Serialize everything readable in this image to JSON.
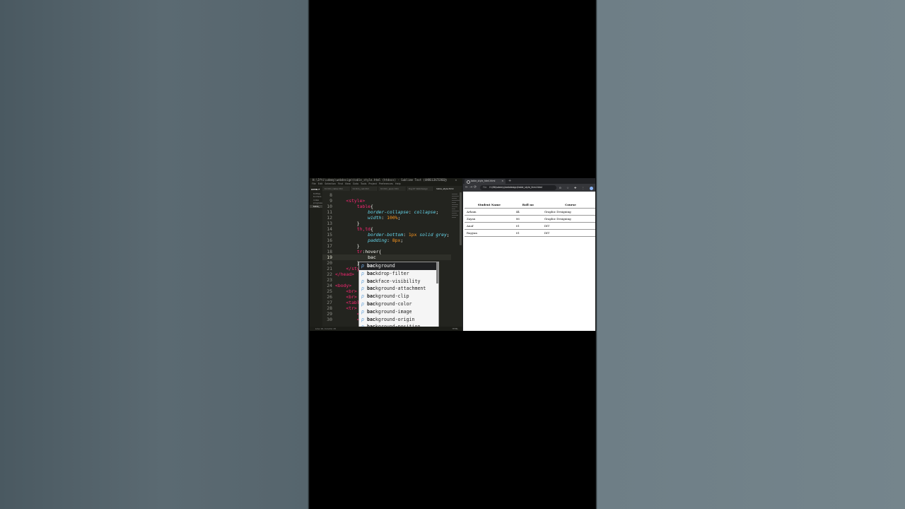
{
  "editor": {
    "title": "H:\\Ifti\\udemy\\webdesign\\table_style.html (htdocs) - Sublime Text (UNREGISTERED)",
    "window_buttons": "–  □  ✕",
    "menu": [
      "File",
      "Edit",
      "Selection",
      "Find",
      "View",
      "Goto",
      "Tools",
      "Project",
      "Preferences",
      "Help"
    ],
    "sidebar_header": "OPEN F",
    "sidebar_files": [
      "tmfiles",
      "borders",
      "index",
      "progress",
      "table_"
    ],
    "tabs": [
      "td.htm_table.htm",
      "td.htm_cell.htm",
      "td.htm_span.htm",
      "Day07 Webdesign",
      "table_style.html"
    ],
    "lines": [
      {
        "n": "8",
        "code": []
      },
      {
        "n": "9",
        "code": [
          {
            "c": "w",
            "t": "    "
          },
          {
            "c": "t",
            "t": "<style>"
          }
        ]
      },
      {
        "n": "10",
        "code": [
          {
            "c": "w",
            "t": "        "
          },
          {
            "c": "t",
            "t": "table"
          },
          {
            "c": "w",
            "t": "{"
          }
        ]
      },
      {
        "n": "11",
        "code": [
          {
            "c": "w",
            "t": "            "
          },
          {
            "c": "pr",
            "t": "border-collapse"
          },
          {
            "c": "w",
            "t": ": "
          },
          {
            "c": "k",
            "t": "collapse"
          },
          {
            "c": "w",
            "t": ";"
          }
        ]
      },
      {
        "n": "12",
        "code": [
          {
            "c": "w",
            "t": "            "
          },
          {
            "c": "pr",
            "t": "width"
          },
          {
            "c": "w",
            "t": ": "
          },
          {
            "c": "v",
            "t": "100%"
          },
          {
            "c": "w",
            "t": ";"
          }
        ]
      },
      {
        "n": "13",
        "code": [
          {
            "c": "w",
            "t": "        }"
          }
        ]
      },
      {
        "n": "14",
        "code": [
          {
            "c": "w",
            "t": "        "
          },
          {
            "c": "t",
            "t": "th,td"
          },
          {
            "c": "w",
            "t": "{"
          }
        ]
      },
      {
        "n": "15",
        "code": [
          {
            "c": "w",
            "t": "            "
          },
          {
            "c": "pr",
            "t": "border-bottom"
          },
          {
            "c": "w",
            "t": ": "
          },
          {
            "c": "v",
            "t": "1px"
          },
          {
            "c": "w",
            "t": " "
          },
          {
            "c": "k",
            "t": "solid grey"
          },
          {
            "c": "w",
            "t": ";"
          }
        ]
      },
      {
        "n": "16",
        "code": [
          {
            "c": "w",
            "t": "            "
          },
          {
            "c": "pr",
            "t": "padding"
          },
          {
            "c": "w",
            "t": ": "
          },
          {
            "c": "v",
            "t": "8px"
          },
          {
            "c": "w",
            "t": ";"
          }
        ]
      },
      {
        "n": "17",
        "code": [
          {
            "c": "w",
            "t": "        }"
          }
        ]
      },
      {
        "n": "18",
        "code": [
          {
            "c": "w",
            "t": "        "
          },
          {
            "c": "t",
            "t": "tr"
          },
          {
            "c": "w",
            "t": ":hover{"
          }
        ]
      },
      {
        "n": "19",
        "code": [
          {
            "c": "w",
            "t": "            bac"
          }
        ]
      },
      {
        "n": "20",
        "code": [
          {
            "c": "w",
            "t": "        }"
          }
        ]
      },
      {
        "n": "21",
        "code": [
          {
            "c": "w",
            "t": "    "
          },
          {
            "c": "t",
            "t": "</sty"
          }
        ]
      },
      {
        "n": "22",
        "code": [
          {
            "c": "t",
            "t": "</head>"
          }
        ]
      },
      {
        "n": "23",
        "code": []
      },
      {
        "n": "24",
        "code": [
          {
            "c": "t",
            "t": "<body>"
          }
        ]
      },
      {
        "n": "25",
        "code": [
          {
            "c": "w",
            "t": "    "
          },
          {
            "c": "t",
            "t": "<br>"
          }
        ]
      },
      {
        "n": "26",
        "code": [
          {
            "c": "w",
            "t": "    "
          },
          {
            "c": "t",
            "t": "<br>"
          }
        ]
      },
      {
        "n": "27",
        "code": [
          {
            "c": "w",
            "t": "    "
          },
          {
            "c": "t",
            "t": "<tabl"
          }
        ]
      },
      {
        "n": "28",
        "code": [
          {
            "c": "w",
            "t": "    "
          },
          {
            "c": "t",
            "t": "<tr>"
          }
        ]
      },
      {
        "n": "29",
        "code": [
          {
            "c": "w",
            "t": "        "
          },
          {
            "c": "t",
            "t": "<"
          }
        ]
      },
      {
        "n": "30",
        "code": [
          {
            "c": "w",
            "t": "        "
          },
          {
            "c": "t",
            "t": "<"
          }
        ]
      }
    ],
    "current_line": "19",
    "autocomplete": [
      {
        "type": "p",
        "match": "bac",
        "rest": "kground"
      },
      {
        "type": "p",
        "match": "bac",
        "rest": "kdrop-filter"
      },
      {
        "type": "p",
        "match": "bac",
        "rest": "kface-visibility"
      },
      {
        "type": "p",
        "match": "bac",
        "rest": "kground-attachment"
      },
      {
        "type": "p",
        "match": "bac",
        "rest": "kground-clip"
      },
      {
        "type": "p",
        "match": "bac",
        "rest": "kground-color"
      },
      {
        "type": "p",
        "match": "bac",
        "rest": "kground-image"
      },
      {
        "type": "p",
        "match": "bac",
        "rest": "kground-origin"
      },
      {
        "type": "p",
        "match": "bac",
        "rest": "kground-position"
      }
    ],
    "status_left": "Line 19, Column 15",
    "status_right": "HTML"
  },
  "browser": {
    "tab_title": "table_style_html.html",
    "tab_close": "✕",
    "new_tab": "+",
    "nav": [
      "←",
      "→",
      "⟳",
      "⌂"
    ],
    "address_prefix": "File",
    "address": "H:/Ifti/udemy/webdesign/table_style_html.html",
    "toolbar_icons": "⊖ ☆ ✚ ⋮",
    "table": {
      "headers": [
        "Student Name",
        "Roll no",
        "Course"
      ],
      "rows": [
        [
          "Arham",
          "44",
          "Graphic Designing"
        ],
        [
          "Zayan",
          "06",
          "Graphic Designing"
        ],
        [
          "Anaf",
          "01",
          "DIT"
        ],
        [
          "Rayyan",
          "01",
          "DIT"
        ]
      ]
    }
  }
}
